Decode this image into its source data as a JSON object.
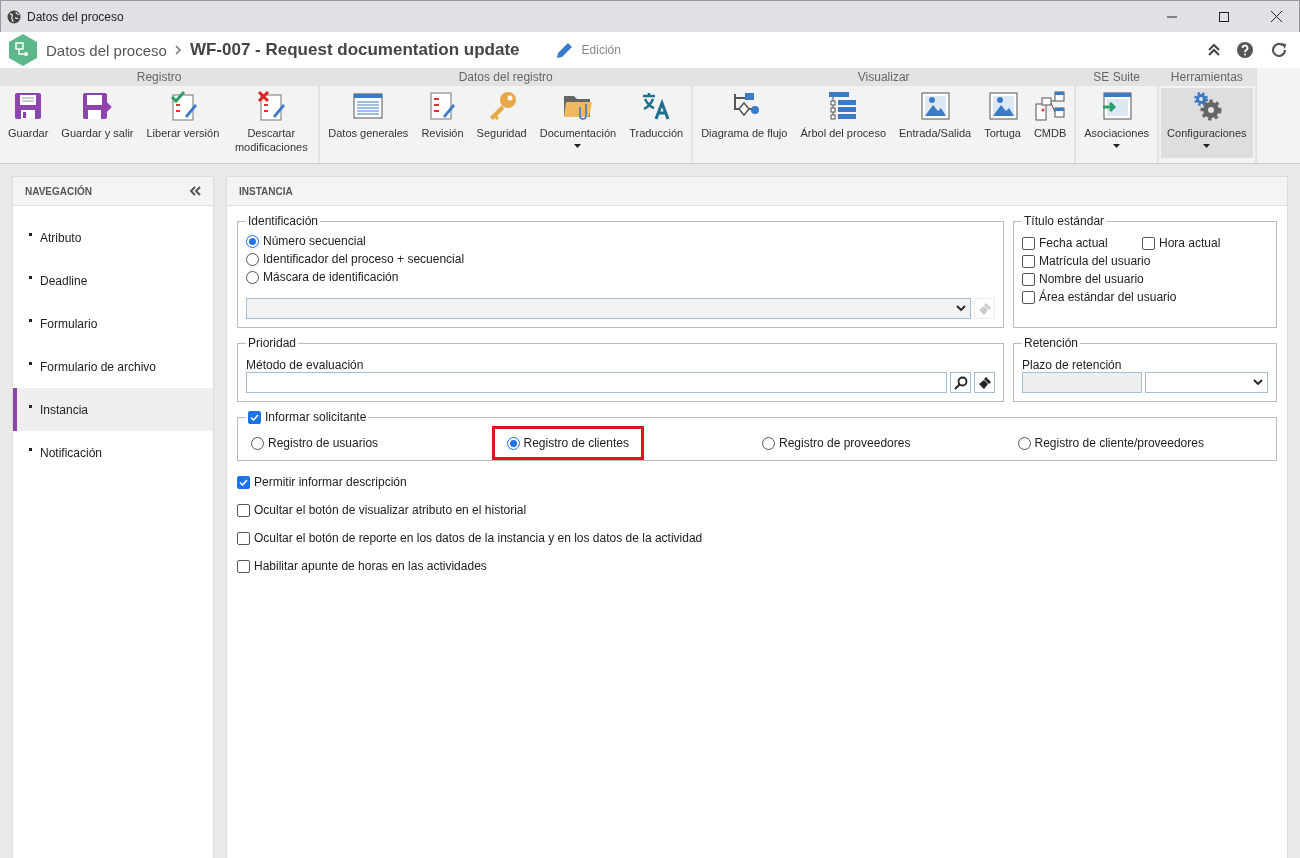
{
  "window": {
    "title": "Datos del proceso"
  },
  "header": {
    "breadcrumb": "Datos del proceso",
    "title": "WF-007 - Request documentation update",
    "mode": "Edición"
  },
  "ribbon": [
    {
      "label": "Registro",
      "buttons": [
        {
          "label": "Guardar",
          "dropdown": false,
          "selected": false
        },
        {
          "label": "Guardar y salir",
          "dropdown": false,
          "selected": false
        },
        {
          "label": "Liberar versión",
          "dropdown": false,
          "selected": false
        },
        {
          "label": "Descartar modificaciones",
          "dropdown": false,
          "selected": false
        }
      ]
    },
    {
      "label": "Datos del registro",
      "buttons": [
        {
          "label": "Datos generales",
          "dropdown": false,
          "selected": false
        },
        {
          "label": "Revisión",
          "dropdown": false,
          "selected": false
        },
        {
          "label": "Seguridad",
          "dropdown": false,
          "selected": false
        },
        {
          "label": "Documentación",
          "dropdown": true,
          "selected": false
        },
        {
          "label": "Traducción",
          "dropdown": false,
          "selected": false
        }
      ]
    },
    {
      "label": "Visualizar",
      "buttons": [
        {
          "label": "Diagrama de flujo",
          "dropdown": false,
          "selected": false
        },
        {
          "label": "Árbol del proceso",
          "dropdown": false,
          "selected": false
        },
        {
          "label": "Entrada/Salida",
          "dropdown": false,
          "selected": false
        },
        {
          "label": "Tortuga",
          "dropdown": false,
          "selected": false
        },
        {
          "label": "CMDB",
          "dropdown": false,
          "selected": false
        }
      ]
    },
    {
      "label": "SE Suite",
      "buttons": [
        {
          "label": "Asociaciones",
          "dropdown": true,
          "selected": false
        }
      ]
    },
    {
      "label": "Herramientas",
      "buttons": [
        {
          "label": "Configuraciones",
          "dropdown": true,
          "selected": true
        }
      ]
    }
  ],
  "sidebar": {
    "title": "NAVEGACIÓN",
    "items": [
      {
        "label": "Atributo",
        "selected": false
      },
      {
        "label": "Deadline",
        "selected": false
      },
      {
        "label": "Formulario",
        "selected": false
      },
      {
        "label": "Formulario de archivo",
        "selected": false
      },
      {
        "label": "Instancia",
        "selected": true
      },
      {
        "label": "Notificación",
        "selected": false
      }
    ]
  },
  "panel": {
    "title": "INSTANCIA",
    "identificacion": {
      "legend": "Identificación",
      "options": [
        {
          "label": "Número secuencial",
          "selected": true
        },
        {
          "label": "Identificador del proceso + secuencial",
          "selected": false
        },
        {
          "label": "Máscara de identificación",
          "selected": false
        }
      ]
    },
    "titulo_estandar": {
      "legend": "Título estándar",
      "options": [
        {
          "label": "Fecha actual",
          "checked": false
        },
        {
          "label": "Hora actual",
          "checked": false
        },
        {
          "label": "Matrícula del usuario",
          "checked": false
        },
        {
          "label": "Nombre del usuario",
          "checked": false
        },
        {
          "label": "Área estándar del usuario",
          "checked": false
        }
      ]
    },
    "prioridad": {
      "legend": "Prioridad",
      "field_label": "Método de evaluación"
    },
    "retencion": {
      "legend": "Retención",
      "field_label": "Plazo de retención"
    },
    "informar_solicitante": {
      "legend": "Informar solicitante",
      "checked": true,
      "options": [
        {
          "label": "Registro de usuarios",
          "selected": false,
          "highlighted": false
        },
        {
          "label": "Registro de clientes",
          "selected": true,
          "highlighted": true
        },
        {
          "label": "Registro de proveedores",
          "selected": false,
          "highlighted": false
        },
        {
          "label": "Registro de cliente/proveedores",
          "selected": false,
          "highlighted": false
        }
      ]
    },
    "options": [
      {
        "label": "Permitir informar descripción",
        "checked": true
      },
      {
        "label": "Ocultar el botón de visualizar atributo en el historial",
        "checked": false
      },
      {
        "label": "Ocultar el botón de reporte en los datos de la instancia y en los datos de la actividad",
        "checked": false
      },
      {
        "label": "Habilitar apunte de horas en las actividades",
        "checked": false
      }
    ]
  }
}
